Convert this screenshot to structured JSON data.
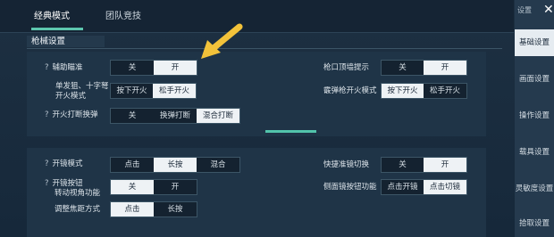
{
  "tabs": [
    "经典模式",
    "团队竞技"
  ],
  "section_title": "枪械设置",
  "panel1": {
    "aim_assist": {
      "label": "辅助瞄准",
      "options": [
        "关",
        "开"
      ],
      "selected": 1
    },
    "single_fire": {
      "label_line1": "单发狙、十字弩",
      "label_line2": "开火模式",
      "options": [
        "按下开火",
        "松手开火"
      ],
      "selected": 1
    },
    "fire_reload": {
      "label": "开火打断换弹",
      "options": [
        "关",
        "换弹打断",
        "混合打断"
      ],
      "selected": 2
    },
    "muzzle_hint": {
      "label": "枪口顶墙提示",
      "options": [
        "关",
        "开"
      ],
      "selected": 1
    },
    "shotgun_fire": {
      "label": "霰弹枪开火模式",
      "options": [
        "按下开火",
        "松手开火"
      ],
      "selected": 0
    }
  },
  "panel2": {
    "scope_mode": {
      "label": "开镜模式",
      "options": [
        "点击",
        "长按",
        "混合"
      ],
      "selected": 1
    },
    "scope_button": {
      "label_line1": "开镜按钮",
      "label_line2": "转动视角功能",
      "options": [
        "关",
        "开"
      ],
      "selected": 0
    },
    "focus_mode": {
      "label": "调整焦距方式",
      "options": [
        "点击",
        "长按"
      ],
      "selected": 0
    },
    "quick_scope": {
      "label": "快捷准镜切换",
      "options": [
        "关",
        "开"
      ],
      "selected": 1
    },
    "side_scope": {
      "label": "侧面镜按钮功能",
      "options": [
        "点击开镜",
        "点击切镜"
      ],
      "selected": 1
    }
  },
  "sidebar": {
    "header": "设置",
    "items": [
      "基础设置",
      "画面设置",
      "操作设置",
      "载具设置",
      "灵敏度设置",
      "拾取设置"
    ],
    "selected": 0
  },
  "colors": {
    "accent": "#5dc6ae",
    "arrow": "#f2c23a",
    "selected_option_bg": "#eef2f5"
  }
}
